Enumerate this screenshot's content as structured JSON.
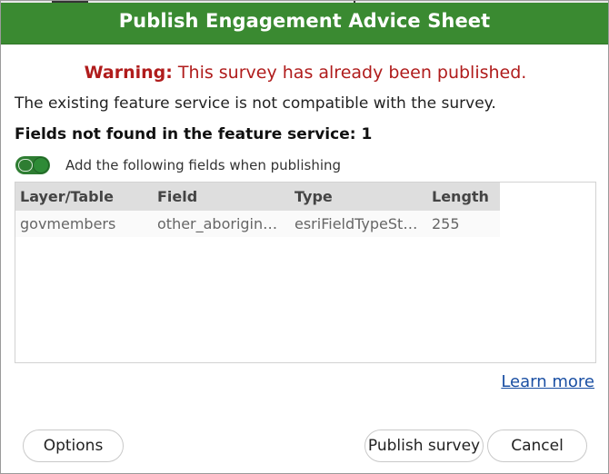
{
  "dialog": {
    "title": "Publish Engagement Advice Sheet",
    "warning_label": "Warning:",
    "warning_text": "This survey has already been published.",
    "message": "The existing feature service is not compatible with the survey.",
    "fields_heading": "Fields not found in the feature service: 1",
    "toggle": {
      "label": "Add the following fields when publishing",
      "on": true,
      "color": "#2e7d32"
    },
    "table": {
      "columns": [
        "Layer/Table",
        "Field",
        "Type",
        "Length"
      ],
      "rows": [
        {
          "layer": "govmembers",
          "field": "other_aborigin…",
          "type": "esriFieldTypeSt…",
          "length": "255"
        }
      ]
    },
    "learn_more": "Learn more",
    "buttons": {
      "options": "Options",
      "publish": "Publish survey",
      "cancel": "Cancel"
    }
  },
  "colors": {
    "title_bar": "#3a8a31",
    "warning": "#b01c1c",
    "link": "#1a4fa3"
  }
}
